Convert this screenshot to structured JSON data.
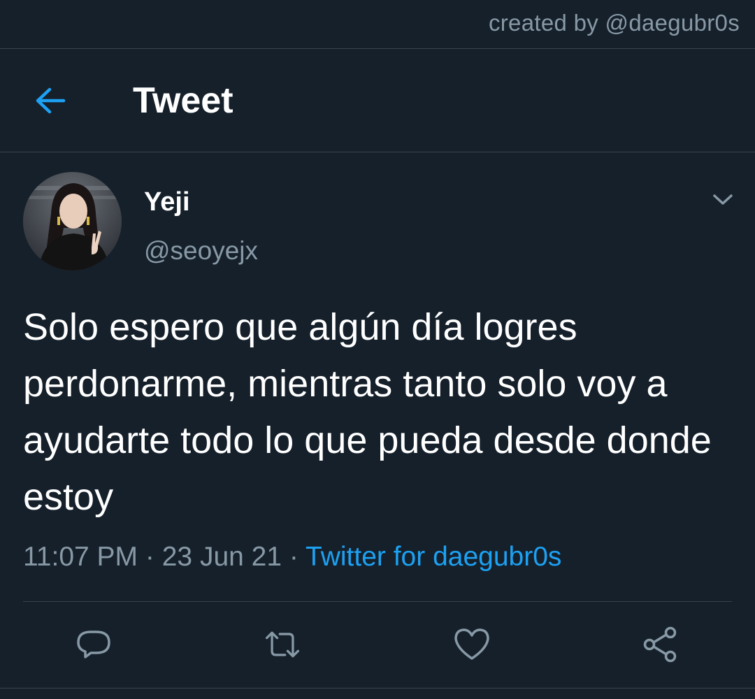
{
  "credit": "created by @daegubr0s",
  "header": {
    "back_icon": "arrow-left-icon",
    "title": "Tweet"
  },
  "tweet": {
    "display_name": "Yeji",
    "handle": "@seoyejx",
    "text": "Solo espero que algún día logres perdonarme, mientras tanto solo voy a ayudarte todo lo que pueda desde donde estoy",
    "time": "11:07 PM",
    "separator": "·",
    "date": "23 Jun 21",
    "client": "Twitter for daegubr0s"
  },
  "actions": [
    {
      "icon": "reply-icon"
    },
    {
      "icon": "retweet-icon"
    },
    {
      "icon": "like-icon"
    },
    {
      "icon": "share-icon"
    }
  ],
  "colors": {
    "background": "#15202b",
    "divider": "#38444d",
    "accent": "#1da1f2",
    "secondary_text": "#8899a6",
    "primary_text": "#ffffff"
  }
}
